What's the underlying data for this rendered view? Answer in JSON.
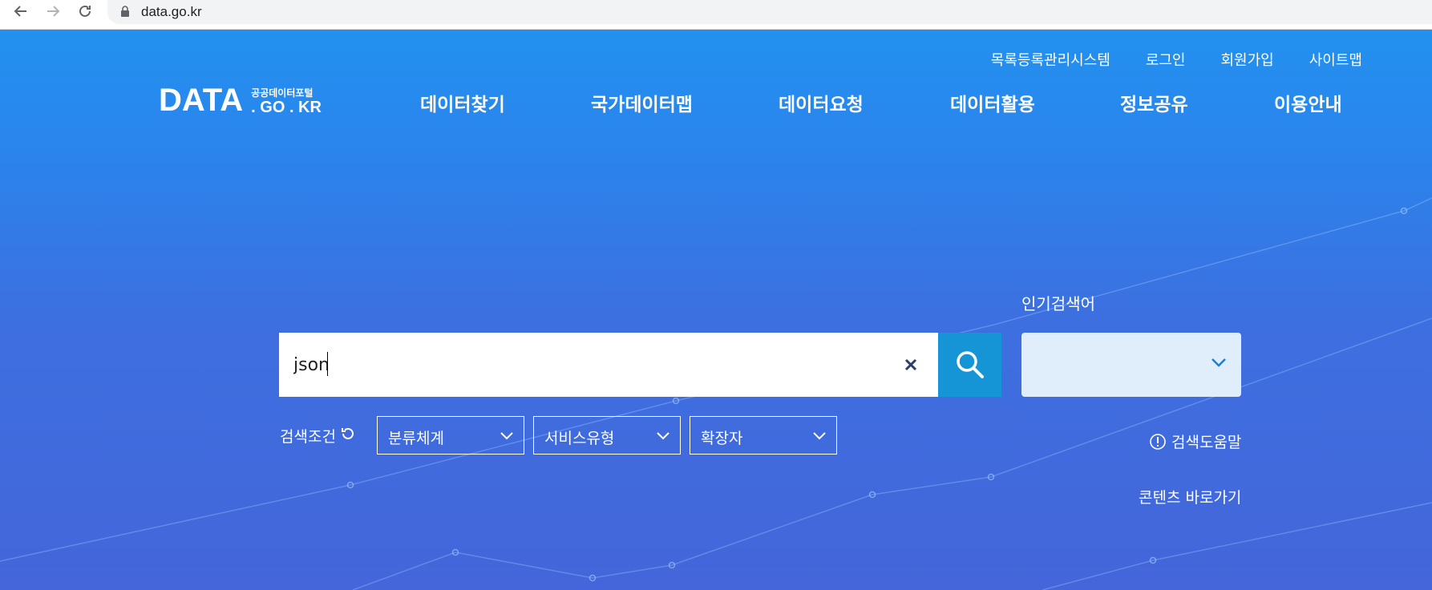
{
  "browser": {
    "url": "data.go.kr"
  },
  "header": {
    "utility_links": [
      "목록등록관리시스템",
      "로그인",
      "회원가입",
      "사이트맵"
    ],
    "logo": {
      "main": "DATA",
      "sub": "공공데이터포털",
      "domain": ". GO . KR"
    },
    "nav": [
      "데이터찾기",
      "국가데이터맵",
      "데이터요청",
      "데이터활용",
      "정보공유",
      "이용안내"
    ]
  },
  "search": {
    "value": "json",
    "popular_label": "인기검색어",
    "popular_value": ""
  },
  "filters": {
    "label": "검색조건",
    "items": [
      "분류체계",
      "서비스유형",
      "확장자"
    ]
  },
  "links": {
    "help": "검색도움말",
    "content": "콘텐츠 바로가기"
  },
  "colors": {
    "hero_top": "#2291ef",
    "hero_bottom": "#4466da",
    "search_button": "#1695d6",
    "popular_select_bg": "#dfeefa"
  }
}
